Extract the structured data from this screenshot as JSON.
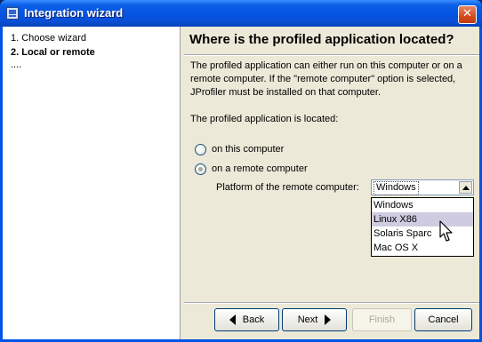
{
  "window": {
    "title": "Integration wizard",
    "close_label": "✕",
    "app_icon": "jprofiler-app-icon"
  },
  "steps": [
    {
      "label": "1. Choose wizard",
      "current": false
    },
    {
      "label": "2. Local or remote",
      "current": true
    },
    {
      "label": "....",
      "current": false
    }
  ],
  "page": {
    "heading": "Where is the profiled application located?",
    "description": "The profiled application can either run on this computer or on a remote computer. If the \"remote computer\" option is selected, JProfiler must be installed on that computer.",
    "located_label": "The profiled application is located:",
    "options": [
      {
        "label": "on this computer",
        "checked": false
      },
      {
        "label": "on a remote computer",
        "checked": true
      }
    ],
    "platform_label": "Platform of the remote computer:",
    "platform": {
      "selected": "Windows",
      "options": [
        "Windows",
        "Linux X86",
        "Solaris Sparc",
        "Mac OS X"
      ],
      "hovered": "Linux X86"
    }
  },
  "buttons": {
    "back": "Back",
    "next": "Next",
    "finish": "Finish",
    "cancel": "Cancel"
  },
  "colors": {
    "titlebar": "#0054e3",
    "dialog_bg": "#ece9d8",
    "close_button": "#d44a1c",
    "dropdown_hover": "#cfcbe0"
  }
}
